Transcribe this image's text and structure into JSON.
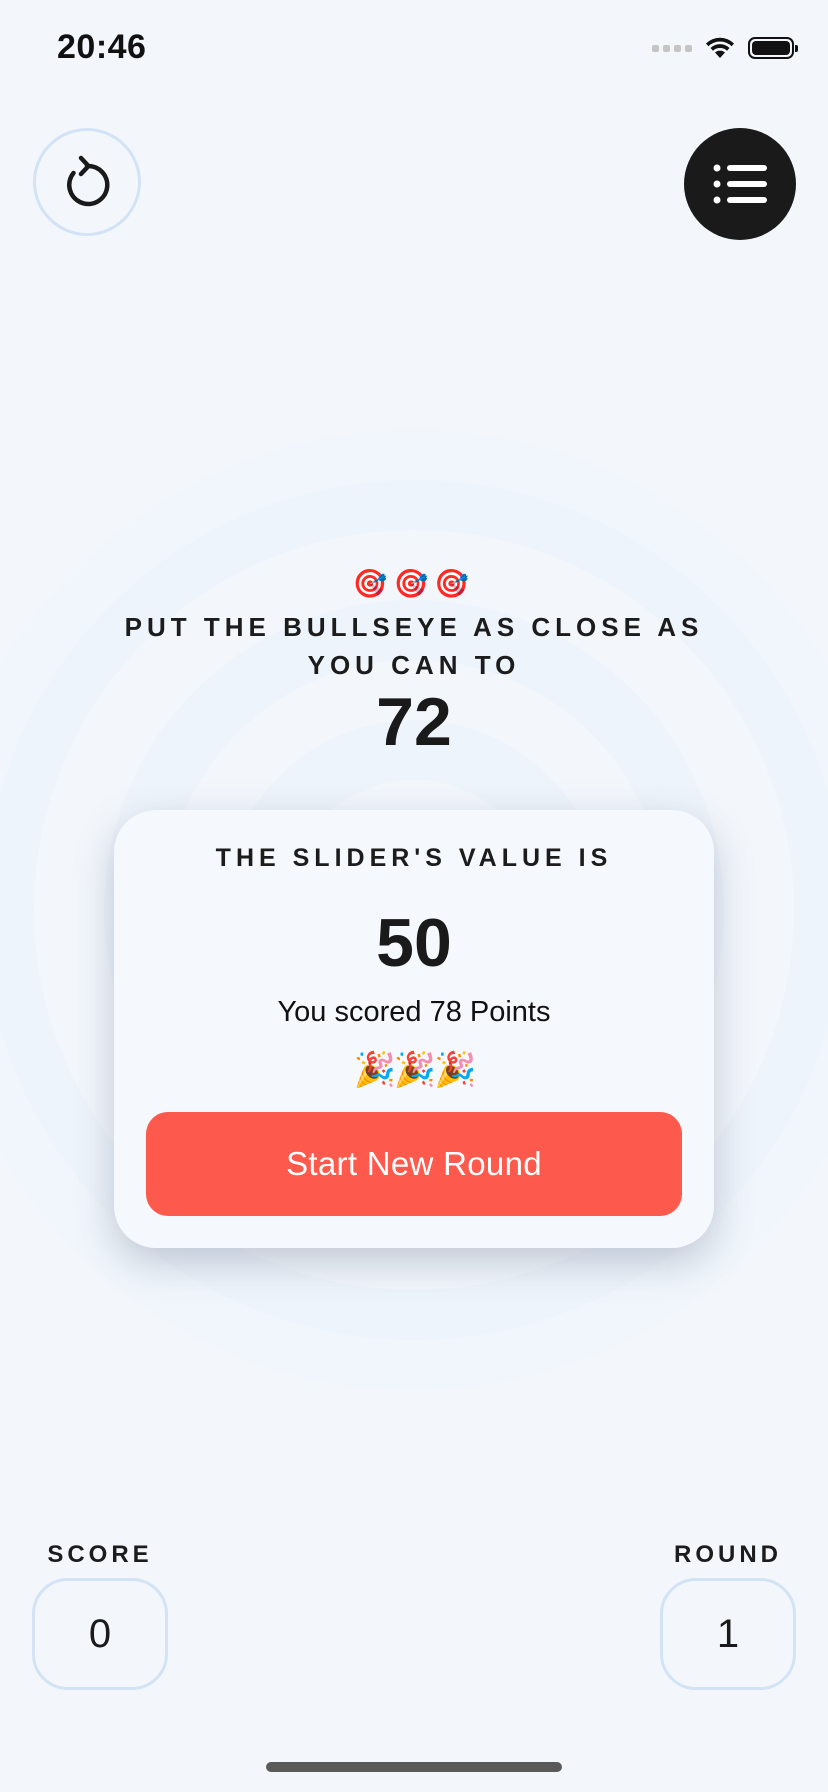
{
  "status_bar": {
    "time": "20:46",
    "icons": [
      "signal-icon",
      "wifi-icon",
      "battery-icon"
    ]
  },
  "top_bar": {
    "restart_icon": "restart-icon",
    "menu_icon": "list-icon"
  },
  "target": {
    "emoji": "🎯🎯🎯",
    "instruction": "PUT THE BULLSEYE AS CLOSE AS YOU CAN TO",
    "value": "72"
  },
  "result": {
    "heading": "THE SLIDER'S VALUE IS",
    "slider_value": "50",
    "message": "You scored 78 Points",
    "emoji": "🎉🎉🎉",
    "button_label": "Start New Round"
  },
  "stats": {
    "score_label": "SCORE",
    "score_value": "0",
    "round_label": "ROUND",
    "round_value": "1"
  },
  "colors": {
    "background": "#f3f7fc",
    "accent": "#fe594d",
    "ring": "#d3e3f6",
    "dark": "#1a1a1a"
  }
}
